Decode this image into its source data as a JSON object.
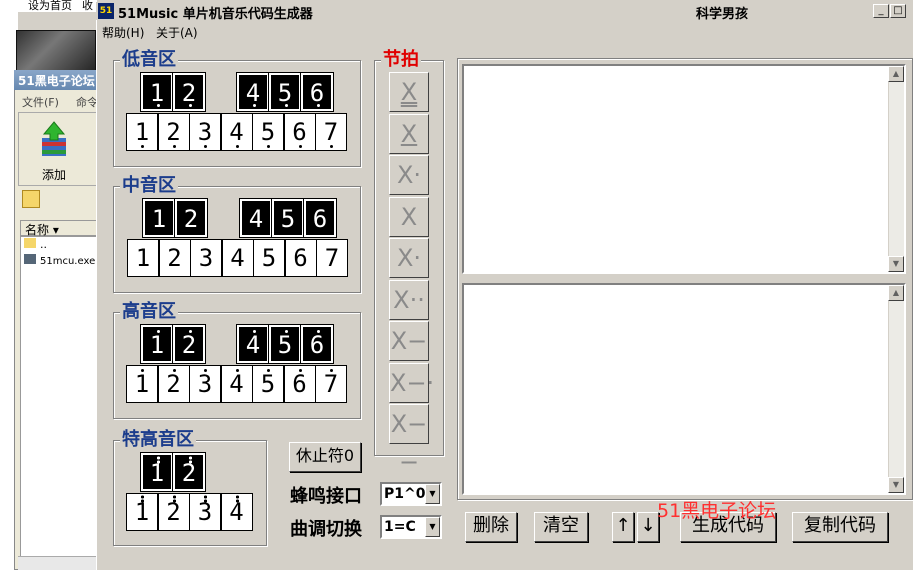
{
  "background_app": {
    "top_link_1": "设为首页",
    "top_link_2": "收",
    "window_title": "51黑电子论坛",
    "menu_file": "文件(F)",
    "menu_cmd": "命令",
    "add_label": "添加",
    "list_header": "名称",
    "list_row_parent": "..",
    "list_row_file": "51mcu.exe"
  },
  "window": {
    "icon_text": "51",
    "title": "51Music 单片机音乐代码生成器",
    "author": "科学男孩",
    "btn_minimize": "_",
    "btn_restore": "□",
    "btn_close": "×"
  },
  "menu": {
    "help": "帮助(H)",
    "about": "关于(A)"
  },
  "groups": {
    "low": "低音区",
    "mid": "中音区",
    "high": "高音区",
    "ultra": "特高音区",
    "beat": "节拍"
  },
  "keys": {
    "low_black": [
      "1",
      "2",
      "4",
      "5",
      "6"
    ],
    "low_white": [
      "1",
      "2",
      "3",
      "4",
      "5",
      "6",
      "7"
    ],
    "mid_black": [
      "1",
      "2",
      "4",
      "5",
      "6"
    ],
    "mid_white": [
      "1",
      "2",
      "3",
      "4",
      "5",
      "6",
      "7"
    ],
    "high_black": [
      "1",
      "2",
      "4",
      "5",
      "6"
    ],
    "high_white": [
      "1",
      "2",
      "3",
      "4",
      "5",
      "6",
      "7"
    ],
    "ultra_black": [
      "1",
      "2"
    ],
    "ultra_white": [
      "1",
      "2",
      "3",
      "4"
    ]
  },
  "beats": [
    "X",
    "X",
    "X·",
    "X",
    "X·",
    "X··",
    "X−",
    "X−·",
    "X−−"
  ],
  "controls": {
    "rest_button": "休止符0",
    "buzzer_label": "蜂鸣接口",
    "buzzer_value": "P1^0",
    "key_label": "曲调切换",
    "key_value": "1=C",
    "delete": "删除",
    "clear": "清空",
    "up": "↑",
    "down": "↓",
    "generate": "生成代码",
    "copy": "复制代码"
  },
  "watermark": "51黑电子论坛",
  "colors": {
    "group_label": "#1c3d8c",
    "beat_label": "#e00000",
    "watermark": "#ff3030"
  }
}
